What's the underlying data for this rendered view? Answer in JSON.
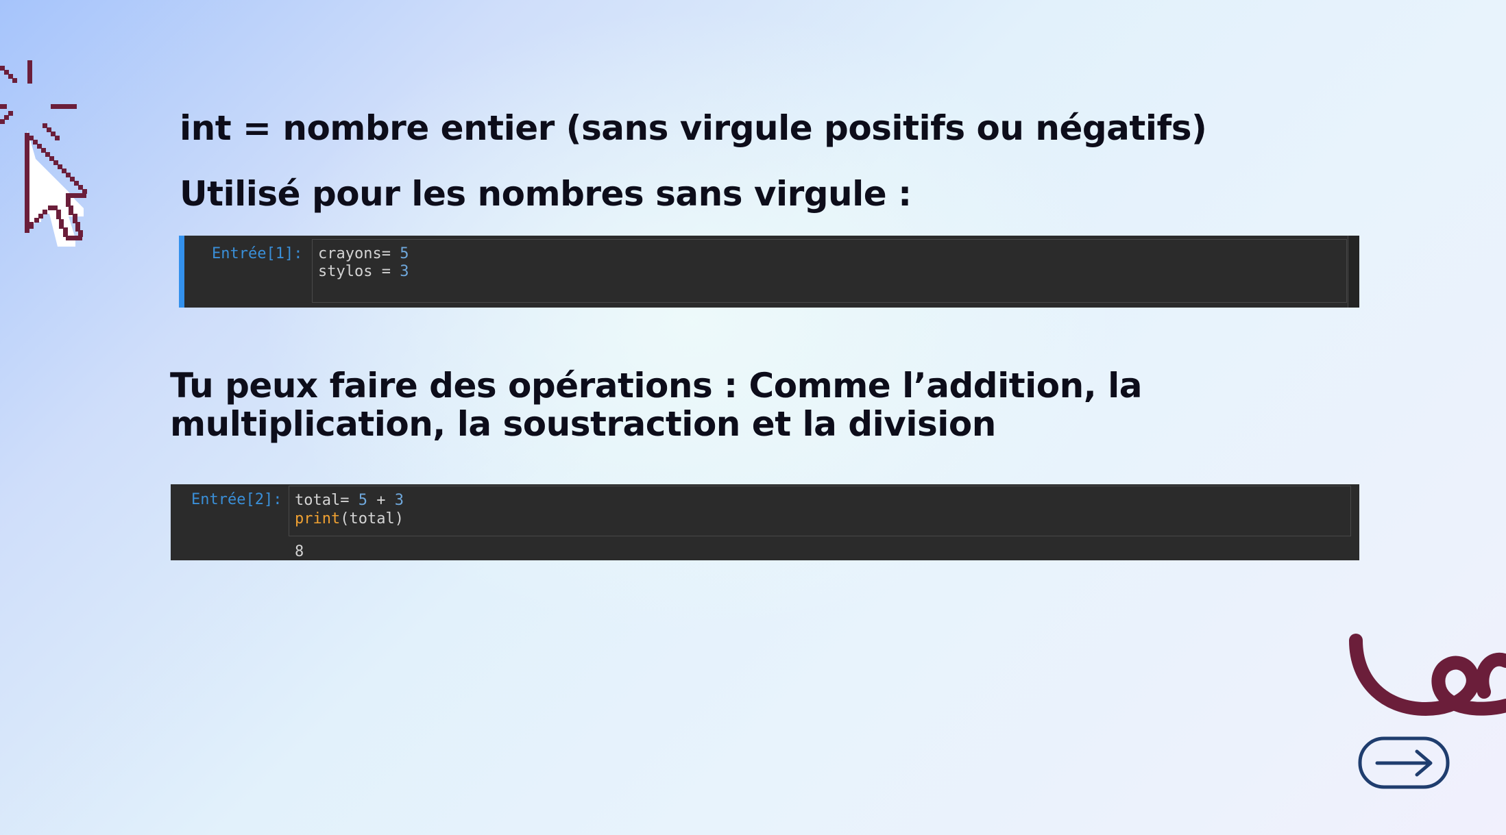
{
  "headings": {
    "line1": "int = nombre entier (sans virgule positifs ou négatifs)",
    "line2": "Utilisé pour les nombres sans virgule :",
    "line3": "Tu peux faire des opérations : Comme l’addition, la multiplication, la soustraction et la division"
  },
  "cell1": {
    "prompt": "Entrée[1]:",
    "line1": {
      "var": "crayons= ",
      "value": "5"
    },
    "line2": {
      "var": "stylos = ",
      "value": "3"
    }
  },
  "cell2": {
    "prompt": "Entrée[2]:",
    "line1": {
      "var": "total= ",
      "a": "5",
      "op": " + ",
      "b": "3"
    },
    "line2": {
      "func": "print",
      "args": "(total)"
    },
    "output": "8"
  },
  "colors": {
    "heading": "#0d0d1a",
    "cell_bg": "#2b2b2b",
    "prompt": "#3a8fd8",
    "number": "#6fa8dc",
    "keyword": "#f0a132",
    "accent_bar": "#3391ed",
    "decor_maroon": "#6b1e3a",
    "arrow_navy": "#1f3d6e"
  },
  "icons": {
    "cursor": "pixel-cursor-click-icon",
    "squiggle": "squiggle-decoration",
    "next": "arrow-right-icon"
  }
}
